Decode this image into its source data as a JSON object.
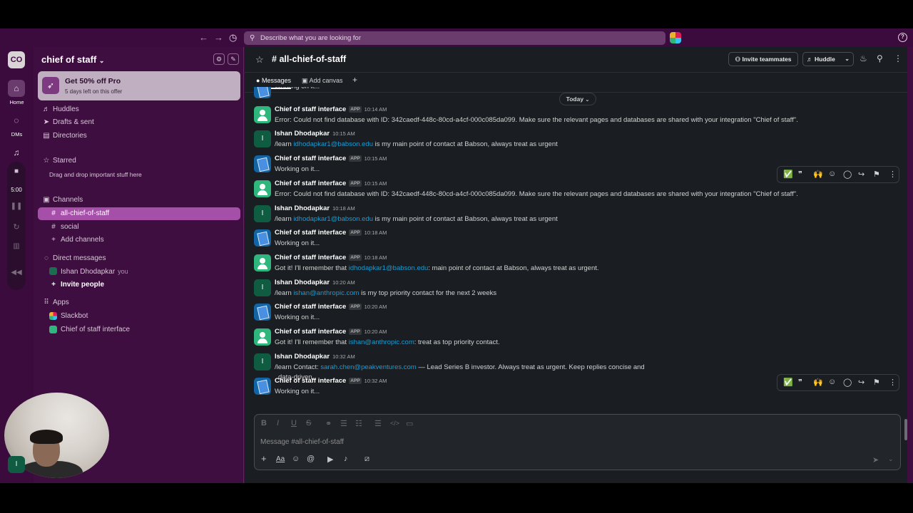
{
  "topbar": {
    "search_placeholder": "Describe what you are looking for"
  },
  "rail": {
    "workspace_initials": "CO",
    "home_label": "Home",
    "dms_label": "DMs",
    "timer": "5:00"
  },
  "sidebar": {
    "workspace_name": "chief of staff",
    "promo_title": "Get 50% off Pro",
    "promo_subtitle": "5 days left on this offer",
    "nav": [
      "Huddles",
      "Drafts & sent",
      "Directories"
    ],
    "starred_label": "Starred",
    "starred_note": "Drag and drop important stuff here",
    "channels_label": "Channels",
    "channels": [
      "all-chief-of-staff",
      "social"
    ],
    "add_channels": "Add channels",
    "dm_label": "Direct messages",
    "dm_user": "Ishan Dhodapkar",
    "dm_you": "you",
    "invite_people": "Invite people",
    "apps_label": "Apps",
    "apps": [
      "Slackbot",
      "Chief of staff interface"
    ]
  },
  "channel": {
    "name": "all-chief-of-staff",
    "invite_label": "Invite teammates",
    "huddle_label": "Huddle",
    "tabs": [
      "Messages",
      "Add canvas"
    ],
    "date_divider": "Today"
  },
  "messages": [
    {
      "type": "doc",
      "sender": "",
      "app": "",
      "time": "",
      "text": "Working on it..."
    },
    {
      "type": "bot",
      "sender": "Chief of staff interface",
      "app": "APP",
      "time": "10:14 AM",
      "text": "Error: Could not find database with ID: 342caedf-448c-80cd-a4cf-000c085da099. Make sure the relevant pages and databases are shared with your integration \"Chief of staff\"."
    },
    {
      "type": "user",
      "sender": "Ishan Dhodapkar",
      "app": "",
      "time": "10:15 AM",
      "pre": "/learn ",
      "link": "idhodapkar1@babson.edu",
      "post": " is my main point of contact at Babson, always treat as urgent"
    },
    {
      "type": "doc",
      "sender": "Chief of staff interface",
      "app": "APP",
      "time": "10:15 AM",
      "text": "Working on it..."
    },
    {
      "type": "bot",
      "sender": "Chief of staff interface",
      "app": "APP",
      "time": "10:15 AM",
      "text": "Error: Could not find database with ID: 342caedf-448c-80cd-a4cf-000c085da099. Make sure the relevant pages and databases are shared with your integration \"Chief of staff\"."
    },
    {
      "type": "user",
      "sender": "Ishan Dhodapkar",
      "app": "",
      "time": "10:18 AM",
      "pre": "/learn ",
      "link": "idhodapkar1@babson.edu",
      "post": " is my main point of contact at Babson, always treat as urgent"
    },
    {
      "type": "doc",
      "sender": "Chief of staff interface",
      "app": "APP",
      "time": "10:18 AM",
      "text": "Working on it..."
    },
    {
      "type": "bot",
      "sender": "Chief of staff interface",
      "app": "APP",
      "time": "10:18 AM",
      "pre": "Got it! I'll remember that ",
      "link": "idhodapkar1@babson.edu",
      "post": ": main point of contact at Babson, always treat as urgent."
    },
    {
      "type": "user",
      "sender": "Ishan Dhodapkar",
      "app": "",
      "time": "10:20 AM",
      "pre": "/learn ",
      "link": "ishan@anthropic.com",
      "post": " is my top priority contact for the next 2 weeks"
    },
    {
      "type": "doc",
      "sender": "Chief of staff interface",
      "app": "APP",
      "time": "10:20 AM",
      "text": "Working on it..."
    },
    {
      "type": "bot",
      "sender": "Chief of staff interface",
      "app": "APP",
      "time": "10:20 AM",
      "pre": "Got it! I'll remember that ",
      "link": "ishan@anthropic.com",
      "post": ": treat as top priority contact."
    },
    {
      "type": "user",
      "sender": "Ishan Dhodapkar",
      "app": "",
      "time": "10:32 AM",
      "pre": "/learn Contact: ",
      "link": "sarah.chen@peakventures.com",
      "post": " — Lead Series B investor. Always treat as urgent. Keep replies concise and",
      "line2": "data-driven."
    },
    {
      "type": "doc",
      "sender": "Chief of staff interface",
      "app": "APP",
      "time": "10:32 AM",
      "text": "Working on it..."
    }
  ],
  "composer": {
    "placeholder": "Message #all-chief-of-staff"
  },
  "webcam_initial": "I"
}
